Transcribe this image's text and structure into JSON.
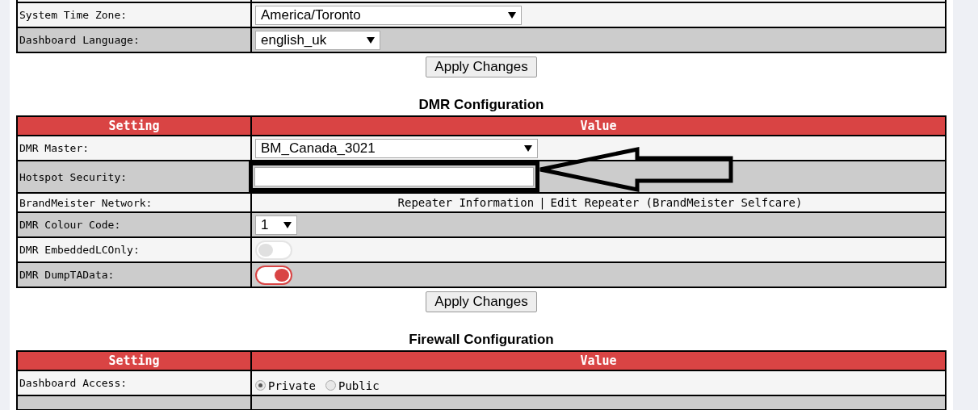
{
  "sections": [
    {
      "rows": [
        {
          "kind": "partial"
        },
        {
          "label": "System Time Zone:",
          "kind": "select",
          "value": "America/Toronto"
        },
        {
          "label": "Dashboard Language:",
          "kind": "select",
          "value": "english_uk"
        }
      ],
      "button": "Apply Changes"
    },
    {
      "title": "DMR Configuration",
      "header": [
        "Setting",
        "Value"
      ],
      "rows": [
        {
          "label": "DMR Master:",
          "kind": "select",
          "value": "BM_Canada_3021"
        },
        {
          "label": "Hotspot Security:",
          "kind": "input",
          "highlighted": true
        },
        {
          "label": "BrandMeister Network:",
          "kind": "links",
          "links": [
            "Repeater Information",
            "Edit Repeater (BrandMeister Selfcare)"
          ],
          "separator": "|"
        },
        {
          "label": "DMR Colour Code:",
          "kind": "select",
          "value": "1"
        },
        {
          "label": "DMR EmbeddedLCOnly:",
          "kind": "toggle",
          "on": false
        },
        {
          "label": "DMR DumpTAData:",
          "kind": "toggle",
          "on": true
        }
      ],
      "button": "Apply Changes"
    },
    {
      "title": "Firewall Configuration",
      "header": [
        "Setting",
        "Value"
      ],
      "rows": [
        {
          "label": "Dashboard Access:",
          "kind": "radio",
          "options": [
            {
              "label": "Private",
              "selected": true
            },
            {
              "label": "Public",
              "selected": false
            }
          ]
        },
        {
          "kind": "partial"
        }
      ]
    }
  ]
}
